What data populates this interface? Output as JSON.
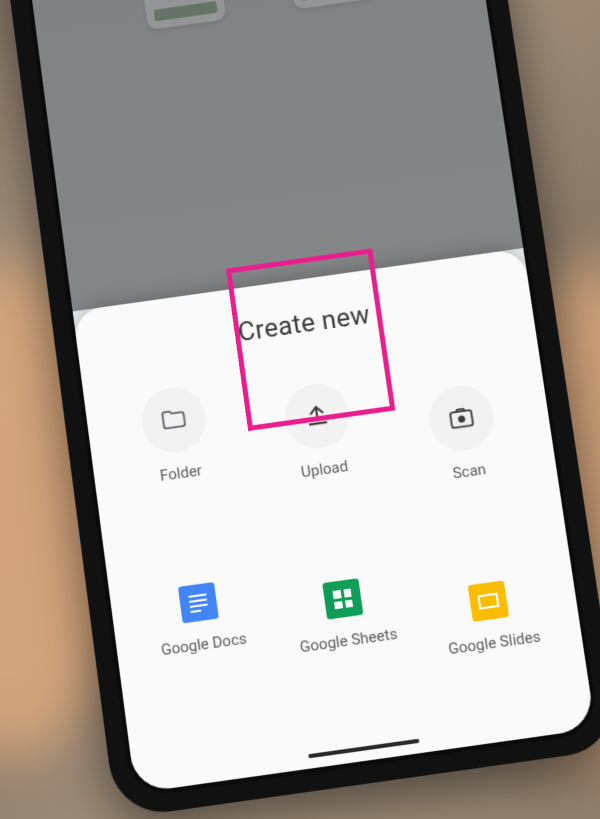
{
  "sheet": {
    "title": "Create new",
    "options": [
      {
        "label": "Folder"
      },
      {
        "label": "Upload"
      },
      {
        "label": "Scan"
      },
      {
        "label": "Google Docs"
      },
      {
        "label": "Google Sheets"
      },
      {
        "label": "Google Slides"
      }
    ]
  },
  "highlight": {
    "target": "upload-option"
  },
  "colors": {
    "highlight": "#e91e8c",
    "docs": "#4285f4",
    "sheets": "#0f9d58",
    "slides": "#fbbc04"
  }
}
